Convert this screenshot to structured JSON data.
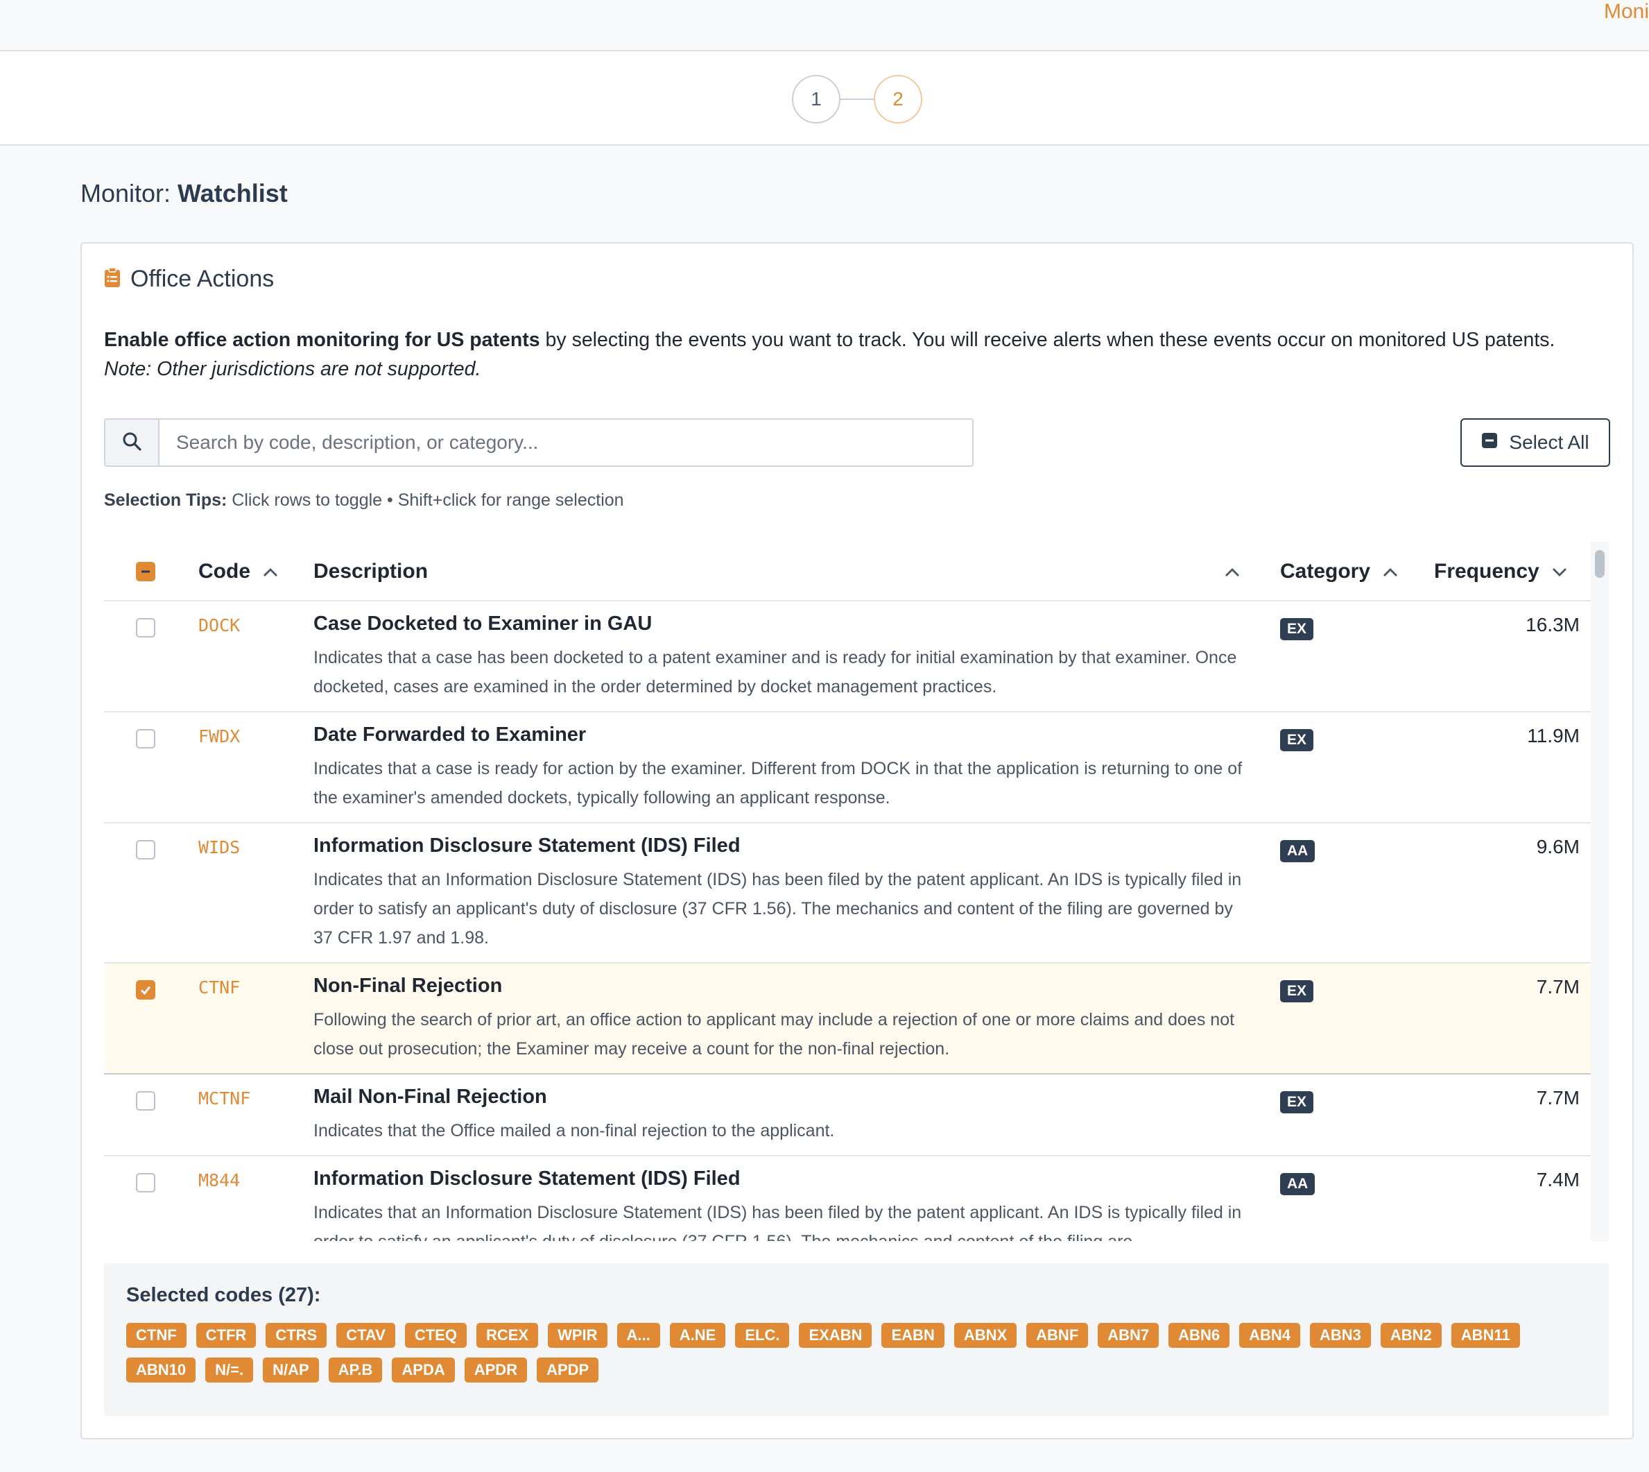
{
  "topbar": {
    "link": "Moni"
  },
  "stepper": {
    "steps": [
      "1",
      "2"
    ]
  },
  "page": {
    "title_prefix": "Monitor: ",
    "title_name": "Watchlist"
  },
  "card": {
    "title": "Office Actions",
    "intro_bold": "Enable office action monitoring for US patents",
    "intro_rest": " by selecting the events you want to track. You will receive alerts when these events occur on monitored US patents.",
    "intro_note": "Note: Other jurisdictions are not supported."
  },
  "search": {
    "placeholder": "Search by code, description, or category...",
    "value": ""
  },
  "select_all_label": "Select All",
  "tips": {
    "label": "Selection Tips:",
    "text": " Click rows to toggle • Shift+click for range selection"
  },
  "table": {
    "headers": {
      "code": "Code",
      "description": "Description",
      "category": "Category",
      "frequency": "Frequency"
    },
    "rows": [
      {
        "code": "DOCK",
        "title": "Case Docketed to Examiner in GAU",
        "body": "Indicates that a case has been docketed to a patent examiner and is ready for initial examination by that examiner. Once docketed, cases are examined in the order determined by docket management practices.",
        "category": "EX",
        "frequency": "16.3M",
        "selected": false
      },
      {
        "code": "FWDX",
        "title": "Date Forwarded to Examiner",
        "body": "Indicates that a case is ready for action by the examiner. Different from DOCK in that the application is returning to one of the examiner's amended dockets, typically following an applicant response.",
        "category": "EX",
        "frequency": "11.9M",
        "selected": false
      },
      {
        "code": "WIDS",
        "title": "Information Disclosure Statement (IDS) Filed",
        "body": "Indicates that an Information Disclosure Statement (IDS) has been filed by the patent applicant. An IDS is typically filed in order to satisfy an applicant's duty of disclosure (37 CFR 1.56). The mechanics and content of the filing are governed by 37 CFR 1.97 and 1.98.",
        "category": "AA",
        "frequency": "9.6M",
        "selected": false
      },
      {
        "code": "CTNF",
        "title": "Non-Final Rejection",
        "body": "Following the search of prior art, an office action to applicant may include a rejection of one or more claims and does not close out prosecution; the Examiner may receive a count for the non-final rejection.",
        "category": "EX",
        "frequency": "7.7M",
        "selected": true
      },
      {
        "code": "MCTNF",
        "title": "Mail Non-Final Rejection",
        "body": "Indicates that the Office mailed a non-final rejection to the applicant.",
        "category": "EX",
        "frequency": "7.7M",
        "selected": false
      },
      {
        "code": "M844",
        "title": "Information Disclosure Statement (IDS) Filed",
        "body": "Indicates that an Information Disclosure Statement (IDS) has been filed by the patent applicant. An IDS is typically filed in order to satisfy an applicant's duty of disclosure (37 CFR 1.56). The mechanics and content of the filing are",
        "category": "AA",
        "frequency": "7.4M",
        "selected": false
      }
    ]
  },
  "selected_codes": {
    "title": "Selected codes (27):",
    "codes": [
      "CTNF",
      "CTFR",
      "CTRS",
      "CTAV",
      "CTEQ",
      "RCEX",
      "WPIR",
      "A...",
      "A.NE",
      "ELC.",
      "EXABN",
      "EABN",
      "ABNX",
      "ABNF",
      "ABN7",
      "ABN6",
      "ABN4",
      "ABN3",
      "ABN2",
      "ABN11",
      "ABN10",
      "N/=.",
      "N/AP",
      "AP.B",
      "APDA",
      "APDR",
      "APDP"
    ]
  },
  "colors": {
    "accent": "#e08a35",
    "badge": "#2f3e52",
    "selected_row": "#fff9ee"
  }
}
